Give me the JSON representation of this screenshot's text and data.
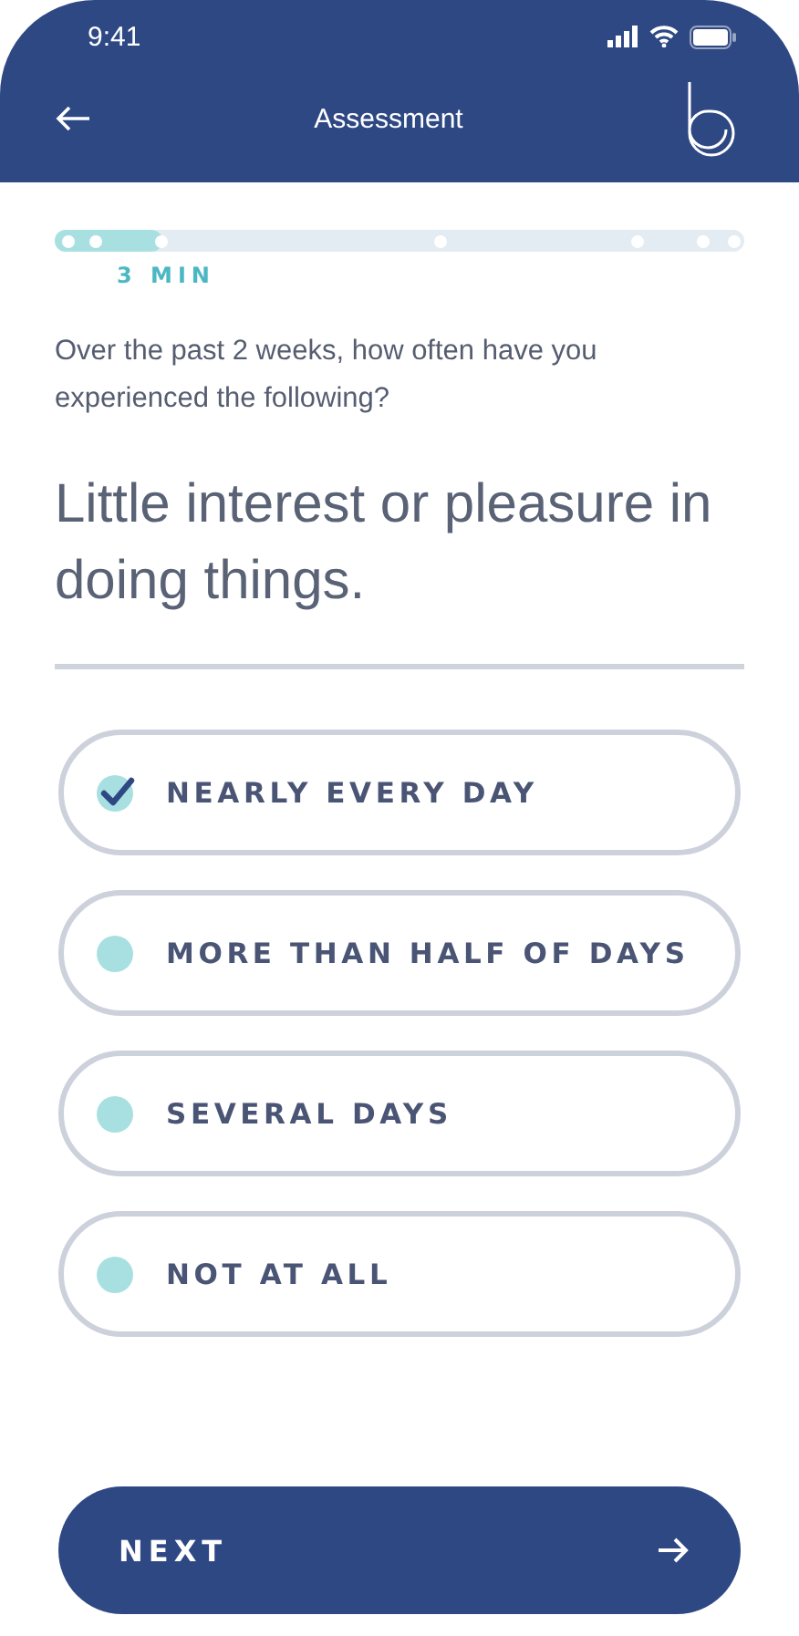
{
  "status_bar": {
    "time": "9:41"
  },
  "header": {
    "title": "Assessment"
  },
  "progress": {
    "level": 0.155,
    "label": "3 MIN"
  },
  "prompt": "Over the past 2 weeks, how often have you experienced the following?",
  "question": "Little interest or pleasure in doing things.",
  "options": [
    {
      "label": "NEARLY EVERY DAY",
      "selected": true
    },
    {
      "label": "MORE THAN HALF OF DAYS",
      "selected": false
    },
    {
      "label": "SEVERAL DAYS",
      "selected": false
    },
    {
      "label": "NOT AT ALL",
      "selected": false
    }
  ],
  "next_button": {
    "label": "NEXT"
  }
}
